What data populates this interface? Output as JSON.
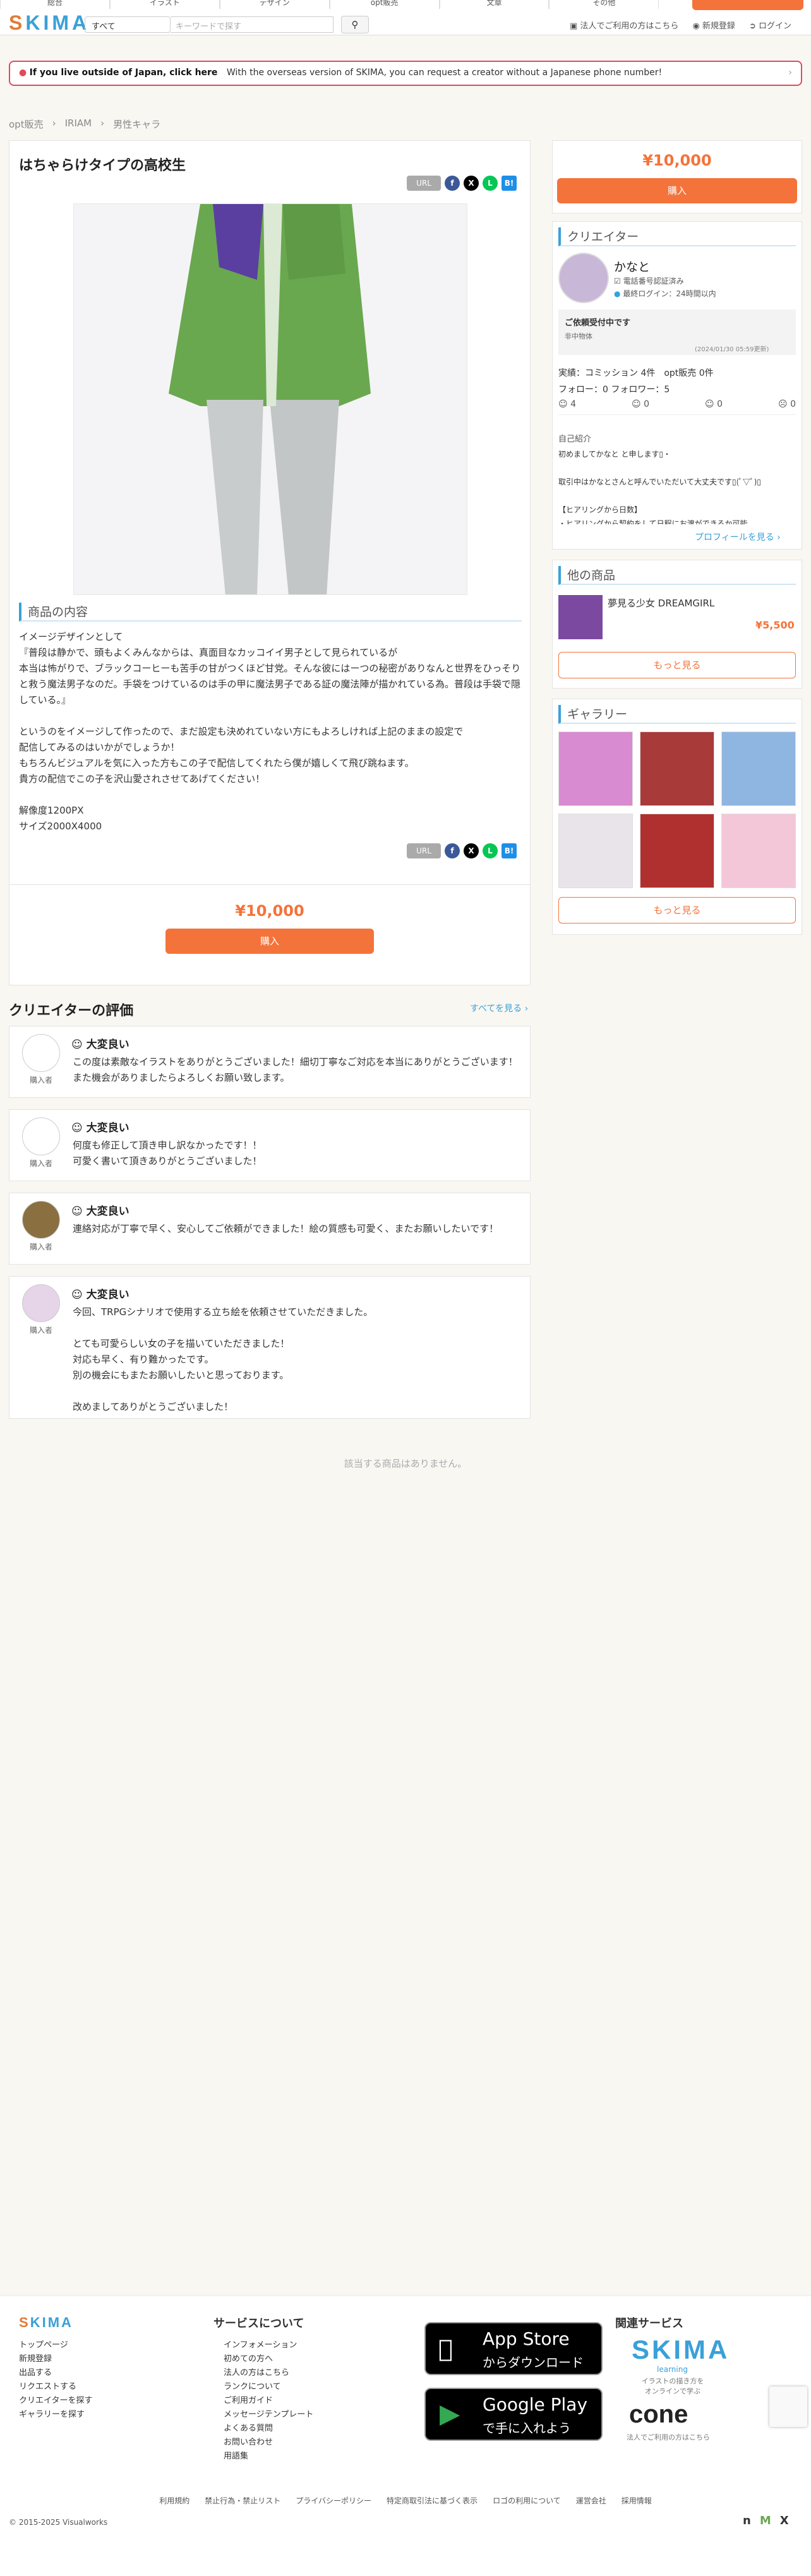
{
  "header": {
    "nav": [
      "総合",
      "イラスト",
      "デザイン",
      "opt販売",
      "文章",
      "その他"
    ],
    "logo": "SKIMA",
    "search_select": "すべて",
    "search_placeholder": "キーワードで探す",
    "links": [
      "法人でご利用の方はこちら",
      "新規登録",
      "ログイン"
    ]
  },
  "notice": {
    "bold": "If you live outside of Japan, click here",
    "text": "With the overseas version of SKIMA, you can request a creator without a Japanese phone number!",
    "arrow": "›"
  },
  "breadcrumb": [
    "opt販売",
    "IRIAM",
    "男性キャラ"
  ],
  "product": {
    "title": "はちゃらけタイプの高校生",
    "share_url": "URL",
    "section_title": "商品の内容",
    "description": "イメージデザインとして\n『普段は静かで、頭もよくみんなからは、真面目なカッコイイ男子として見られているが\n本当は怖がりで、ブラックコーヒーも苦手の甘がつくほど甘党。そんな彼にはーつの秘密がありなんと世界をひっそりと救う魔法男子なのだ。手袋をつけているのは手の甲に魔法男子である証の魔法陣が描かれている為。普段は手袋で隠している。』\n\nというのをイメージして作ったので、まだ設定も決めれていない方にもよろしければ上記のままの設定で\n配信してみるのはいかがでしょうか！\nもちろんビジュアルを気に入った方もこの子で配信してくれたら僕が嬉しくて飛び跳ねます。\n貴方の配信でこの子を沢山愛されさせてあげてください！\n\n解像度1200PX\nサイズ2000X4000",
    "price": "¥10,000",
    "buy": "購入"
  },
  "sidebar": {
    "price": "¥10,000",
    "buy": "購入",
    "creator_title": "クリエイター",
    "creator_name": "かなと",
    "phone_verified": "電話番号認証済み",
    "last_login": "最終ログイン：24時間以内",
    "status": "ご依頼受付中です",
    "status_sub": "非中物体",
    "status_date": "(2024/01/30 05:59更新)",
    "stats": "実績：コミッション 4件　opt販売 0件",
    "follow": "フォロー：0 フォロワー：5",
    "ratings": [
      "4",
      "0",
      "0",
      "0"
    ],
    "intro_title": "自己紹介",
    "intro": "初めましてかなと と申します▯・\n\n取引中はかなとさんと呼んでいただいて大丈夫です▯(ﾟ▽ﾟ)▯\n\n【ヒアリングから日数】\n・ヒアリングから契約をして日程にお渡ができるか可能",
    "profile_link": "プロフィールを見る ›",
    "other_title": "他の商品",
    "other_name": "夢見る少女 DREAMGIRL",
    "other_price": "¥5,500",
    "more": "もっと見る",
    "gallery_title": "ギャラリー",
    "gallery_more": "もっと見る"
  },
  "reviews": {
    "title": "クリエイターの評価",
    "see_all": "すべてを見る ›",
    "items": [
      {
        "level": "大変良い",
        "role": "購入者",
        "text": "この度は素敵なイラストをありがとうございました！細切丁寧なご対応を本当にありがとうございます！\nまた機会がありましたらよろしくお願い致します。"
      },
      {
        "level": "大変良い",
        "role": "購入者",
        "text": "何度も修正して頂き申し訳なかったです！！\n可愛く書いて頂きありがとうございました！"
      },
      {
        "level": "大変良い",
        "role": "購入者",
        "text": "連絡対応が丁寧で早く、安心してご依頼ができました！絵の質感も可愛く、またお願いしたいです！"
      },
      {
        "level": "大変良い",
        "role": "購入者",
        "text": "今回、TRPGシナリオで使用する立ち絵を依頼させていただきました。\n\nとても可愛らしい女の子を描いていただきました！\n対応も早く、有り難かったです。\n別の機会にもまたお願いしたいと思っております。\n\n改めましてありがとうございました！"
      }
    ]
  },
  "empty_msg": "該当する商品はありません。",
  "footer": {
    "logo": "SKIMA",
    "col1": [
      "トップページ",
      "新規登録",
      "出品する",
      "リクエストする",
      "クリエイターを探す",
      "ギャラリーを探す"
    ],
    "col2_title": "サービスについて",
    "col2": [
      "インフォメーション",
      "初めての方へ",
      "法人の方はこちら",
      "ランクについて",
      "ご利用ガイド",
      "メッセージテンプレート",
      "よくある質問",
      "お問い合わせ",
      "用語集"
    ],
    "app1_a": "App Store",
    "app1_b": "からダウンロード",
    "app2_a": "Google Play",
    "app2_b": "で手に入れよう",
    "related_title": "関連サービス",
    "rel1": "SKIMA",
    "rel1_sub": "learning",
    "rel1_desc": "イラストの描き方を\nオンラインで学ぶ",
    "rel2": "cone",
    "rel2_desc": "法人でご利用の方はこちら",
    "bottom_links": [
      "利用規約",
      "禁止行為・禁止リスト",
      "プライバシーポリシー",
      "特定商取引法に基づく表示",
      "ロゴの利用について",
      "運営会社",
      "採用情報"
    ],
    "copyright": "© 2015-2025 Visualworks"
  },
  "colors": {
    "accent": "#f4733a",
    "blue": "#3aa0d8",
    "notice_red": "#e04a5a"
  }
}
